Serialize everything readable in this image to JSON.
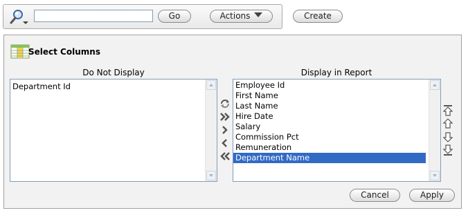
{
  "toolbar": {
    "search_value": "",
    "go_label": "Go",
    "actions_label": "Actions",
    "create_label": "Create"
  },
  "panel": {
    "title": "Select Columns",
    "left_heading": "Do Not Display",
    "right_heading": "Display in Report",
    "left_items": [
      "Department Id"
    ],
    "right_items": [
      "Employee Id",
      "First Name",
      "Last Name",
      "Hire Date",
      "Salary",
      "Commission Pct",
      "Remuneration",
      "Department Name"
    ],
    "selected_item": "Department Name",
    "cancel_label": "Cancel",
    "apply_label": "Apply"
  },
  "icons": {
    "search": "magnifier-icon",
    "select_columns": "table-columns-icon",
    "reset": "reset-icon",
    "move_all": "move-all-right-icon",
    "move": "move-right-icon",
    "remove": "move-left-icon",
    "remove_all": "move-all-left-icon",
    "top": "move-top-icon",
    "up": "move-up-icon",
    "down": "move-down-icon",
    "bottom": "move-bottom-icon"
  },
  "colors": {
    "selection": "#316ac5",
    "panel_bg": "#f2f2f2",
    "border": "#a0a0a0"
  }
}
